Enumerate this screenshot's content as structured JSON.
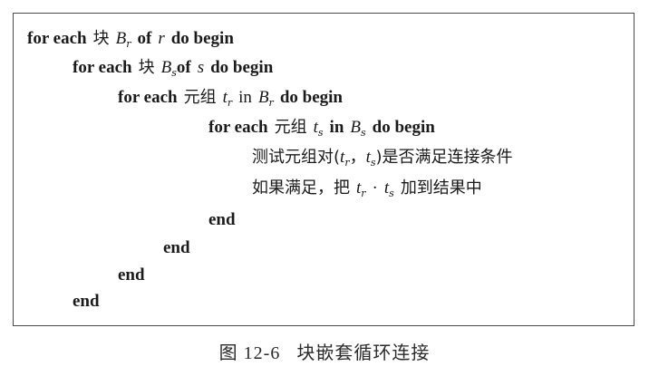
{
  "code": {
    "line1": {
      "kw1": "for each",
      "zh": "块",
      "var": "B",
      "sub": "r",
      "kw2": "of",
      "var2": "r",
      "kw3": "do begin"
    },
    "line2": {
      "kw1": "for each",
      "zh": "块",
      "var": "B",
      "sub": "s",
      "kw2": "of",
      "var2": "s",
      "kw3": "do begin"
    },
    "line3": {
      "kw1": "for each",
      "zh": "元组",
      "var": "t",
      "sub": "r",
      "plain": "in",
      "var2": "B",
      "sub2": "r",
      "kw3": "do begin"
    },
    "line4": {
      "kw1": "for each",
      "zh": "元组",
      "var": "t",
      "sub": "s",
      "kw2": "in",
      "var2": "B",
      "sub2": "s",
      "kw3": "do begin"
    },
    "line5": {
      "zh1": "测试元组对(",
      "var1": "t",
      "sub1": "r",
      "comma": "，",
      "var2": "t",
      "sub2": "s",
      "zh2": ")是否满足连接条件"
    },
    "line6": {
      "zh1": "如果满足，把",
      "var1": "t",
      "sub1": "r",
      "dot": "·",
      "var2": "t",
      "sub2": "s",
      "zh2": "加到结果中"
    },
    "end1": "end",
    "end2": "end",
    "end3": "end",
    "end4": "end"
  },
  "caption": {
    "number": "图 12-6",
    "title": "块嵌套循环连接"
  }
}
